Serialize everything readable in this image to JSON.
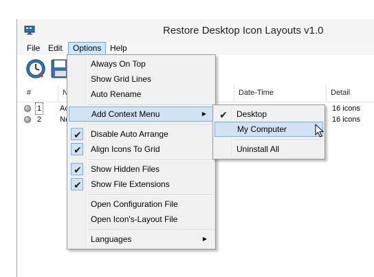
{
  "window": {
    "title": "Restore Desktop Icon Layouts v1.0"
  },
  "menubar": {
    "items": [
      "File",
      "Edit",
      "Options",
      "Help"
    ],
    "open_index": 2
  },
  "toolbar": {
    "buttons": [
      "restore-clock-icon",
      "save-disk-icon"
    ]
  },
  "grid": {
    "columns": [
      "#",
      "Na",
      "Date-Time",
      "Detail"
    ],
    "rows": [
      {
        "num": "1",
        "name": "Ac",
        "detail": "16 icons"
      },
      {
        "num": "2",
        "name": "Ne",
        "detail": "16 icons"
      }
    ]
  },
  "options_menu": {
    "items": [
      {
        "label": "Always On Top",
        "checked": false
      },
      {
        "label": "Show Grid Lines",
        "checked": false
      },
      {
        "label": "Auto Rename",
        "checked": false
      },
      {
        "label": "Add Context Menu",
        "checked": false,
        "submenu": true,
        "highlighted": true
      },
      {
        "label": "Disable Auto Arrange",
        "checked": true
      },
      {
        "label": "Align Icons To Grid",
        "checked": true
      },
      {
        "label": "Show Hidden Files",
        "checked": true
      },
      {
        "label": "Show File Extensions",
        "checked": true
      },
      {
        "label": "Open Configuration File",
        "checked": false
      },
      {
        "label": "Open Icon's-Layout File",
        "checked": false
      },
      {
        "label": "Languages",
        "checked": false,
        "submenu": true
      }
    ]
  },
  "context_submenu": {
    "items": [
      {
        "label": "Desktop",
        "checked": true
      },
      {
        "label": "My Computer",
        "checked": false,
        "highlighted": true
      },
      {
        "label": "Uninstall All",
        "checked": false
      }
    ]
  },
  "check_glyph": "✔",
  "arrow_glyph": "▶"
}
